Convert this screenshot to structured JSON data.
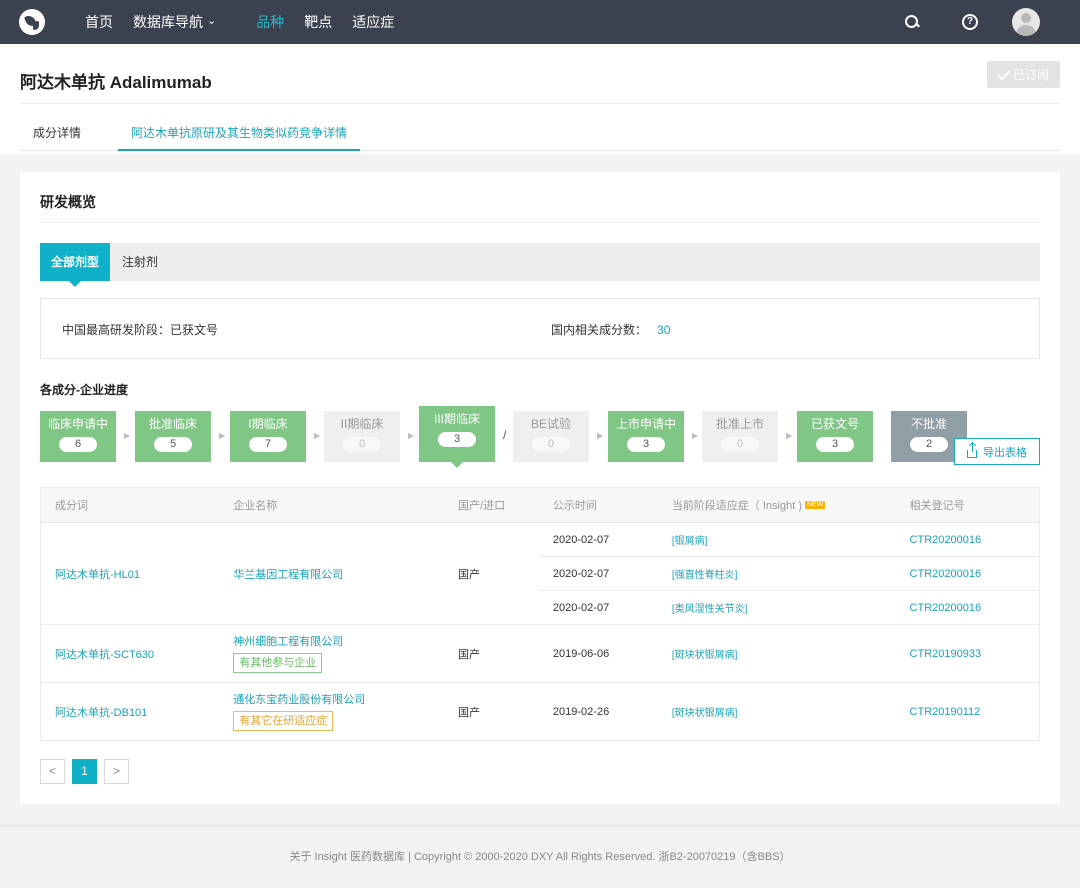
{
  "nav": {
    "items": [
      "首页",
      "数据库导航",
      "品种",
      "靶点",
      "适应症"
    ],
    "icons": [
      "search-icon",
      "help-icon",
      "avatar"
    ]
  },
  "header": {
    "title": "阿达木单抗 Adalimumab",
    "subscribe_label": "已订阅",
    "tabs": [
      "成分详情",
      "阿达木单抗原研及其生物类似药竞争详情"
    ]
  },
  "overview": {
    "title": "研发概览",
    "subtabs": [
      "全部剂型",
      "注射剂"
    ],
    "highest_stage": "中国最高研发阶段：已获文号",
    "related_label": "国内相关成分数：",
    "related_count": "30"
  },
  "progress": {
    "title": "各成分-企业进度",
    "stages": [
      {
        "label": "临床申请中",
        "count": "6"
      },
      {
        "label": "批准临床",
        "count": "5"
      },
      {
        "label": "I期临床",
        "count": "7"
      },
      {
        "label": "II期临床",
        "count": "0"
      },
      {
        "label": "III期临床",
        "count": "3"
      },
      {
        "label": "BE试验",
        "count": "0"
      },
      {
        "label": "上市申请中",
        "count": "3"
      },
      {
        "label": "批准上市",
        "count": "0"
      },
      {
        "label": "已获文号",
        "count": "3"
      },
      {
        "label": "不批准",
        "count": "2"
      }
    ],
    "slash": "/",
    "export_label": "导出表格"
  },
  "table": {
    "headers": [
      "成分词",
      "企业名称",
      "国产/进口",
      "公示时间",
      "当前阶段适应症（ Insight )",
      "相关登记号"
    ],
    "new_badge": "NEW",
    "groups": [
      {
        "ingredient": "阿达木单抗-HL01",
        "company": "华兰基因工程有限公司",
        "origin": "国产",
        "rows": [
          {
            "date": "2020-02-07",
            "indication": "[银屑病]",
            "reg": "CTR20200016"
          },
          {
            "date": "2020-02-07",
            "indication": "[强直性脊柱炎]",
            "reg": "CTR20200016"
          },
          {
            "date": "2020-02-07",
            "indication": "[类风湿性关节炎]",
            "reg": "CTR20200016"
          }
        ]
      },
      {
        "ingredient": "阿达木单抗-SCT630",
        "company": "神州细胞工程有限公司",
        "tag": "有其他参与企业",
        "origin": "国产",
        "rows": [
          {
            "date": "2019-06-06",
            "indication": "[斑块状银屑病]",
            "reg": "CTR20190933"
          }
        ]
      },
      {
        "ingredient": "阿达木单抗-DB101",
        "company": "通化东宝药业股份有限公司",
        "tag": "有其它在研适应症",
        "origin": "国产",
        "rows": [
          {
            "date": "2019-02-26",
            "indication": "[斑块状银屑病]",
            "reg": "CTR20190112"
          }
        ]
      }
    ]
  },
  "pagination": {
    "prev": "<",
    "current": "1",
    "next": ">"
  },
  "footer": {
    "text": "关于 Insight 医药数据库 | Copyright © 2000-2020 DXY All Rights Reserved. 浙B2-20070219（含BBS）"
  }
}
